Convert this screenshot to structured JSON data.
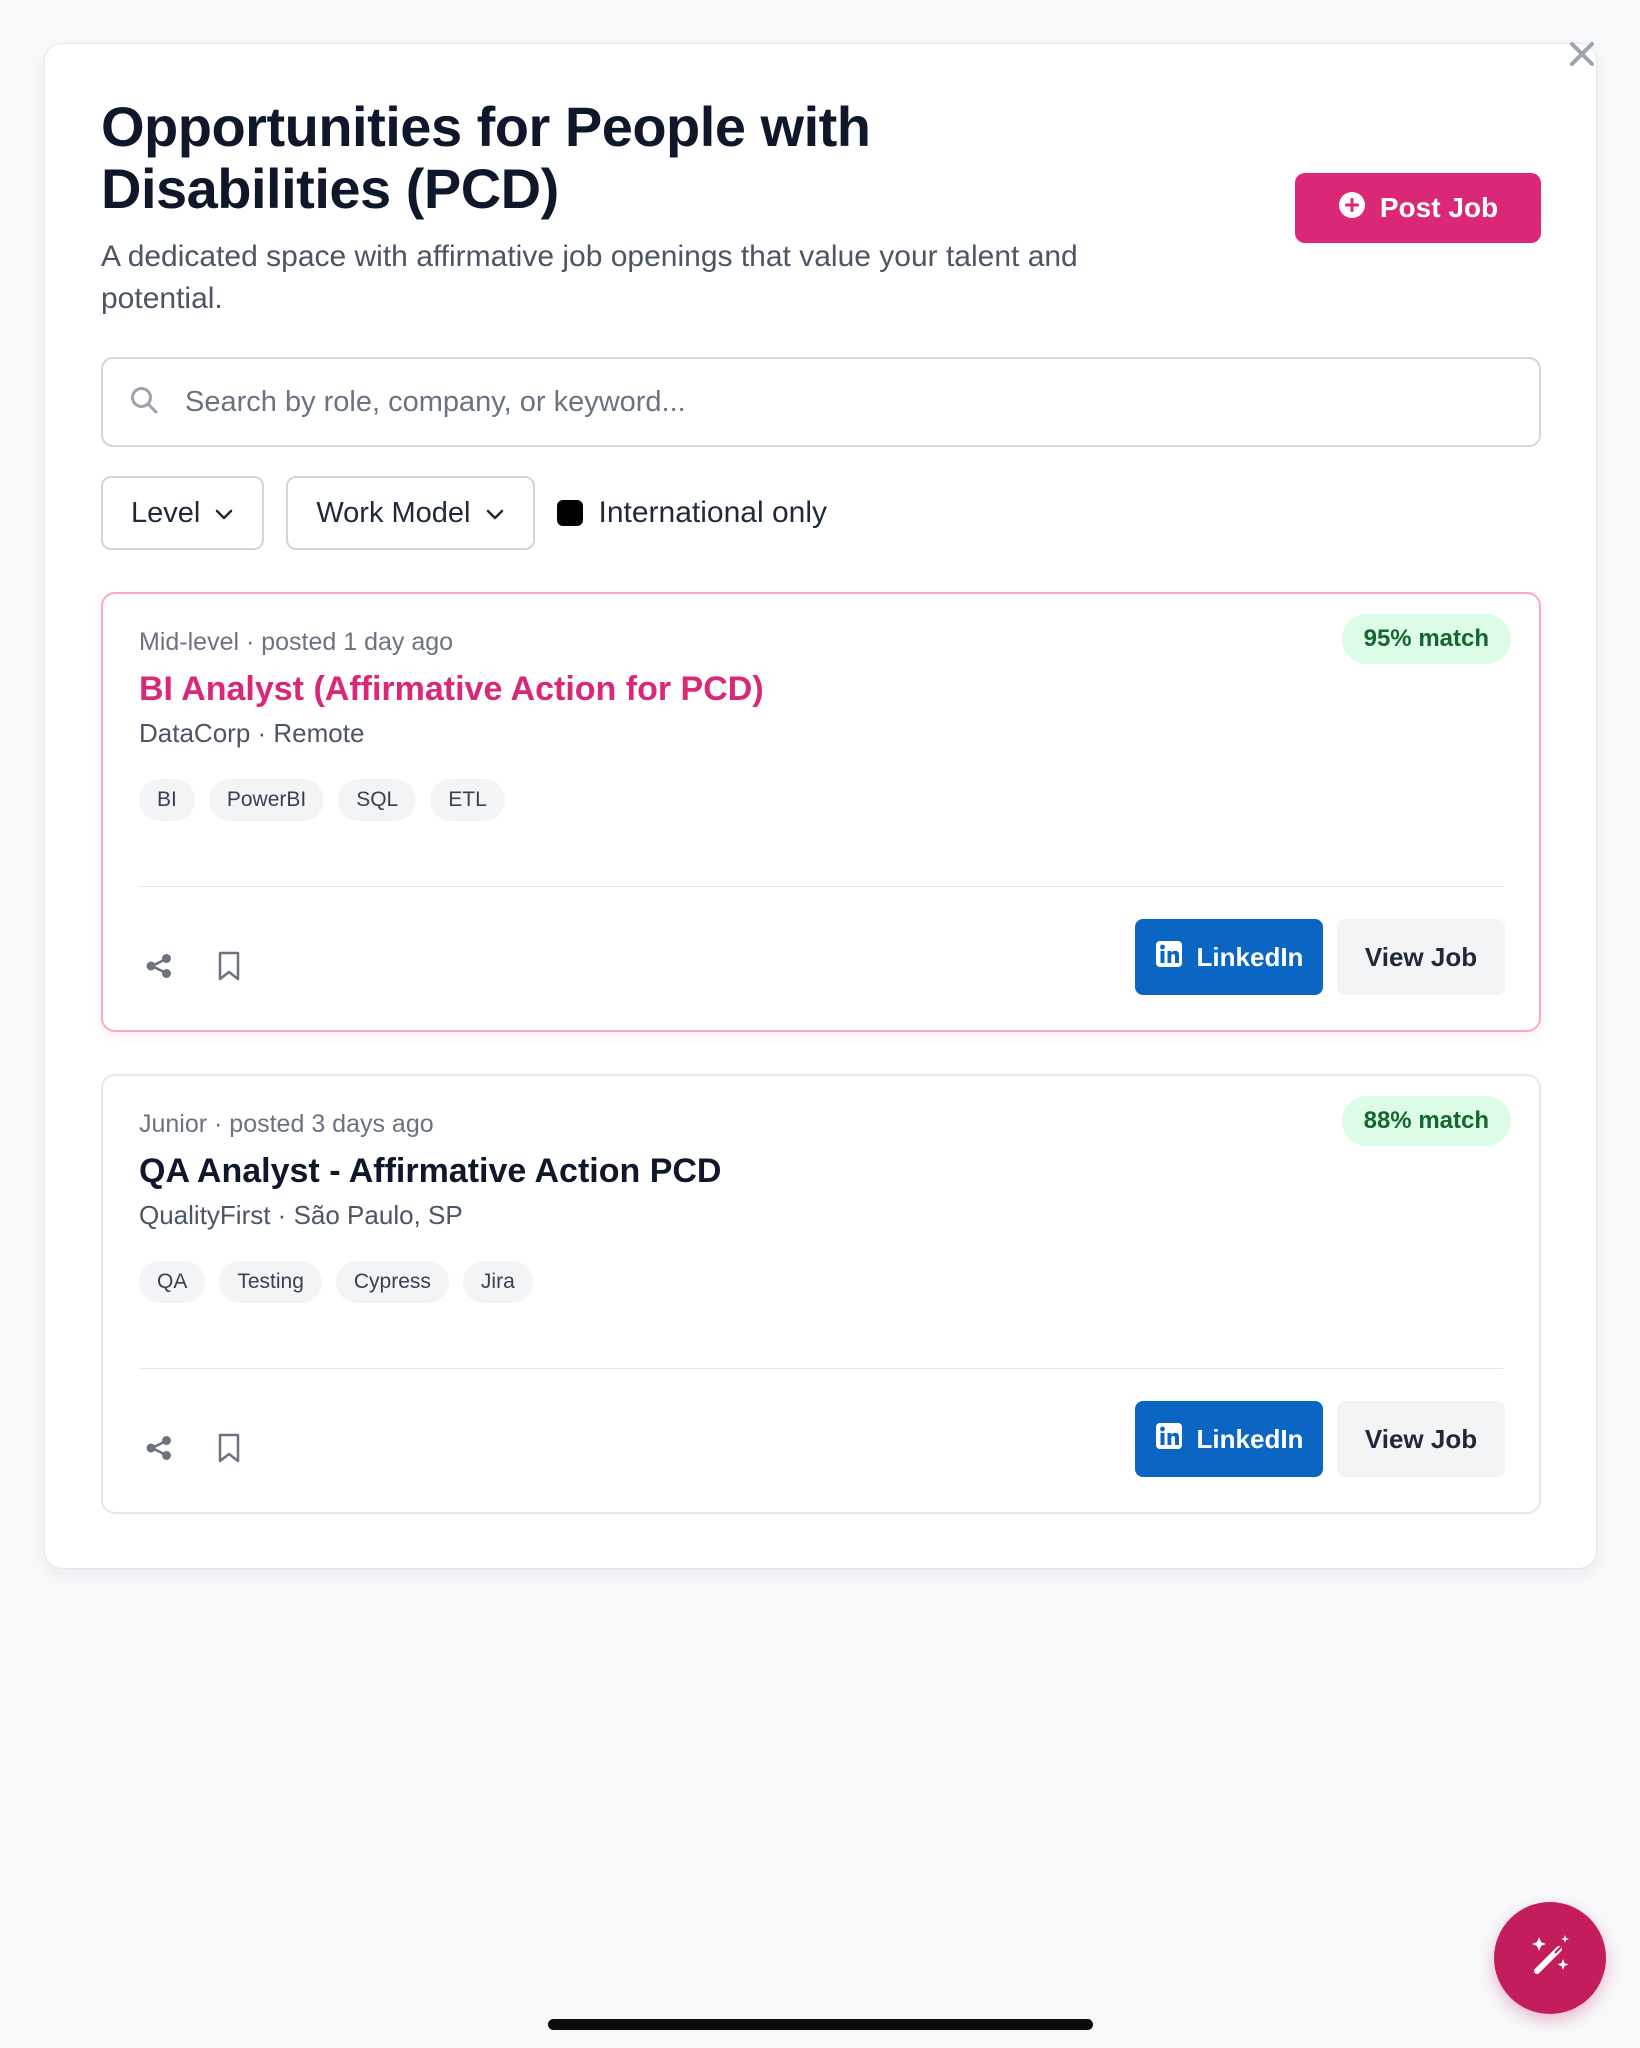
{
  "dialog": {
    "close_label": "×"
  },
  "header": {
    "title": "Opportunities for People with Disabilities (PCD)",
    "subtitle": "A dedicated space with affirmative job openings that value your talent and potential.",
    "post_job_label": "Post Job"
  },
  "search": {
    "placeholder": "Search by role, company, or keyword...",
    "value": ""
  },
  "filters": {
    "level_label": "Level",
    "work_model_label": "Work Model",
    "international_label": "International only",
    "international_checked": true
  },
  "jobs": [
    {
      "meta": "Mid-level · posted 1 day ago",
      "title": "BI Analyst (Affirmative Action for PCD)",
      "company_location": "DataCorp · Remote",
      "match": "95% match",
      "tags": [
        "BI",
        "PowerBI",
        "SQL",
        "ETL"
      ],
      "linkedin_label": "LinkedIn",
      "view_label": "View Job",
      "highlighted": true
    },
    {
      "meta": "Junior · posted 3 days ago",
      "title": "QA Analyst - Affirmative Action PCD",
      "company_location": "QualityFirst · São Paulo, SP",
      "match": "88% match",
      "tags": [
        "QA",
        "Testing",
        "Cypress",
        "Jira"
      ],
      "linkedin_label": "LinkedIn",
      "view_label": "View Job",
      "highlighted": false
    }
  ],
  "icons": {
    "close": "close-icon",
    "post": "plus-circle-icon",
    "search": "search-icon",
    "chevron": "chevron-down-icon",
    "share": "share-icon",
    "bookmark": "bookmark-icon",
    "linkedin": "linkedin-icon",
    "fab": "magic-wand-icon"
  },
  "colors": {
    "accent": "#db2777",
    "linkedin": "#0a66c2",
    "match_bg": "#dcfce7",
    "match_text": "#166534",
    "fab": "#c41d5d"
  }
}
